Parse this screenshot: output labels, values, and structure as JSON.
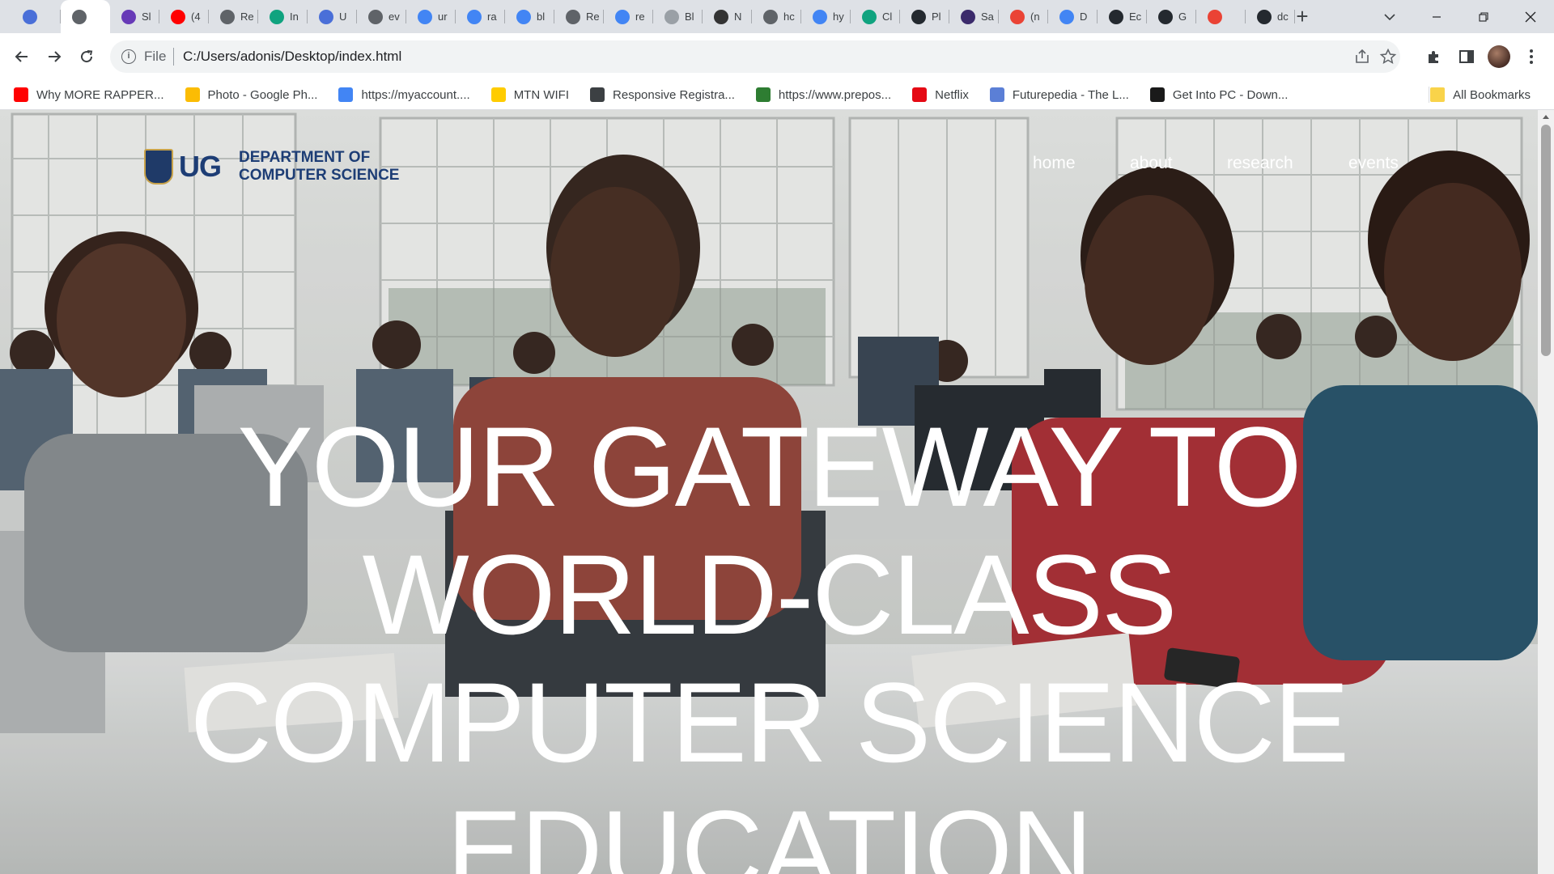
{
  "browser": {
    "tabs": [
      {
        "title": "",
        "icon": "app-icon",
        "color": "#4a6fd8"
      },
      {
        "title": "",
        "icon": "globe-icon",
        "color": "#5f6368",
        "active": true
      },
      {
        "title": "Sl",
        "icon": "list-icon",
        "color": "#673ab7"
      },
      {
        "title": "(4",
        "icon": "youtube-icon",
        "color": "#ff0000"
      },
      {
        "title": "Re",
        "icon": "globe-icon",
        "color": "#5f6368"
      },
      {
        "title": "In",
        "icon": "openai-icon",
        "color": "#10a37f"
      },
      {
        "title": "U",
        "icon": "app-icon",
        "color": "#4a6fd8"
      },
      {
        "title": "ev",
        "icon": "globe-icon",
        "color": "#5f6368"
      },
      {
        "title": "ur",
        "icon": "google-icon",
        "color": "#4285f4"
      },
      {
        "title": "ra",
        "icon": "google-icon",
        "color": "#4285f4"
      },
      {
        "title": "bl",
        "icon": "google-icon",
        "color": "#4285f4"
      },
      {
        "title": "Re",
        "icon": "globe-icon",
        "color": "#5f6368"
      },
      {
        "title": "re",
        "icon": "google-icon",
        "color": "#4285f4"
      },
      {
        "title": "Bl",
        "icon": "dots-icon",
        "color": "#9aa0a6"
      },
      {
        "title": "N",
        "icon": "globe-icon",
        "color": "#333333"
      },
      {
        "title": "hc",
        "icon": "globe-icon",
        "color": "#5f6368"
      },
      {
        "title": "hy",
        "icon": "google-icon",
        "color": "#4285f4"
      },
      {
        "title": "Cl",
        "icon": "openai-icon",
        "color": "#10a37f"
      },
      {
        "title": "Pl",
        "icon": "github-icon",
        "color": "#24292f"
      },
      {
        "title": "Sa",
        "icon": "shield-icon",
        "color": "#3b2a6b"
      },
      {
        "title": "(n",
        "icon": "gmail-icon",
        "color": "#ea4335"
      },
      {
        "title": "D",
        "icon": "docs-icon",
        "color": "#4285f4"
      },
      {
        "title": "Ec",
        "icon": "github-icon",
        "color": "#24292f"
      },
      {
        "title": "G",
        "icon": "github-icon",
        "color": "#24292f"
      },
      {
        "title": "",
        "icon": "gmail-icon",
        "color": "#ea4335"
      },
      {
        "title": "dc",
        "icon": "github-icon",
        "color": "#24292f"
      }
    ],
    "new_tab": "+",
    "address": {
      "scheme_label": "File",
      "url": "C:/Users/adonis/Desktop/index.html"
    },
    "bookmarks": [
      {
        "label": "Why MORE RAPPER...",
        "icon": "youtube-icon",
        "color": "#ff0000"
      },
      {
        "label": "Photo - Google Ph...",
        "icon": "photos-icon",
        "color": "#fbbc04"
      },
      {
        "label": "https://myaccount....",
        "icon": "google-icon",
        "color": "#4285f4"
      },
      {
        "label": "MTN WIFI",
        "icon": "mtn-icon",
        "color": "#ffcc00"
      },
      {
        "label": "Responsive Registra...",
        "icon": "globe-icon",
        "color": "#3c4043"
      },
      {
        "label": "https://www.prepos...",
        "icon": "prepostseo-icon",
        "color": "#2e7d32"
      },
      {
        "label": "Netflix",
        "icon": "netflix-icon",
        "color": "#e50914"
      },
      {
        "label": "Futurepedia - The L...",
        "icon": "futurepedia-icon",
        "color": "#5b7fd6"
      },
      {
        "label": "Get Into PC - Down...",
        "icon": "getintopc-icon",
        "color": "#1a1a1a"
      }
    ],
    "all_bookmarks_label": "All Bookmarks"
  },
  "page": {
    "logo": {
      "abbr": "UG",
      "line1": "DEPARTMENT OF",
      "line2": "COMPUTER SCIENCE"
    },
    "nav": [
      {
        "label": "home"
      },
      {
        "label": "about"
      },
      {
        "label": "research"
      },
      {
        "label": "events"
      }
    ],
    "hero": {
      "lines": [
        "YOUR GATEWAY TO",
        "WORLD-CLASS",
        "COMPUTER SCIENCE",
        "EDUCATION"
      ]
    }
  }
}
